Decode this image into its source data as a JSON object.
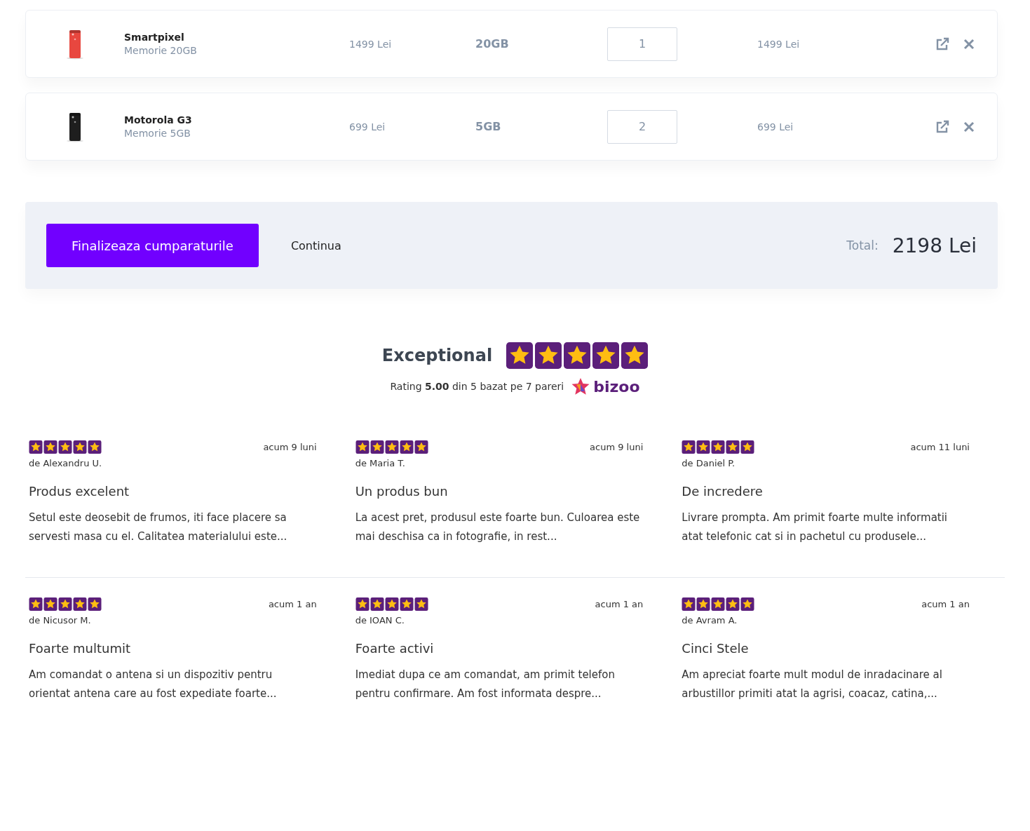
{
  "cart_items": [
    {
      "name": "Smartpixel",
      "variant": "Memorie 20GB",
      "price": "1499 Lei",
      "memory": "20GB",
      "quantity": "1",
      "total": "1499 Lei"
    },
    {
      "name": "Motorola G3",
      "variant": "Memorie 5GB",
      "price": "699 Lei",
      "memory": "5GB",
      "quantity": "2",
      "total": "699 Lei"
    }
  ],
  "checkout": {
    "primary_button": "Finalizeaza cumparaturile",
    "secondary_button": "Continua",
    "total_label": "Total:",
    "total_value": "2198 Lei"
  },
  "rating_summary": {
    "title": "Exceptional",
    "stars": 5,
    "text": "Rating **5.00** din 5 bazat pe 7 pareri",
    "logo": "bizoo"
  },
  "reviews": [
    {
      "stars": 5,
      "time": "acum 9 luni",
      "author": "de Alexandru U.",
      "title": "Produs excelent",
      "text": "Setul este deosebit de frumos, iti face placere sa servesti masa cu el. Calitatea materialului este..."
    },
    {
      "stars": 5,
      "time": "acum 9 luni",
      "author": "de Maria T.",
      "title": "Un produs bun",
      "text": "La acest pret, produsul este foarte bun. Culoarea este mai deschisa ca in fotografie, in rest..."
    },
    {
      "stars": 5,
      "time": "acum 11 luni",
      "author": "de Daniel P.",
      "title": "De incredere",
      "text": "Livrare prompta. Am primit foarte multe informatii atat telefonic cat si in pachetul cu produsele..."
    },
    {
      "stars": 5,
      "time": "acum 1 an",
      "author": "de Nicusor M.",
      "title": "Foarte multumit",
      "text": "Am comandat o antena si un dispozitiv pentru orientat antena care au fost expediate foarte..."
    },
    {
      "stars": 5,
      "time": "acum 1 an",
      "author": "de IOAN C.",
      "title": "Foarte activi",
      "text": "Imediat dupa ce am comandat, am primit telefon pentru confirmare. Am fost informata despre..."
    },
    {
      "stars": 5,
      "time": "acum 1 an",
      "author": "de Avram A.",
      "title": "Cinci Stele",
      "text": "Am apreciat foarte mult modul de inradacinare al arbustillor primiti atat la agrisi, coacaz, catina,..."
    }
  ]
}
